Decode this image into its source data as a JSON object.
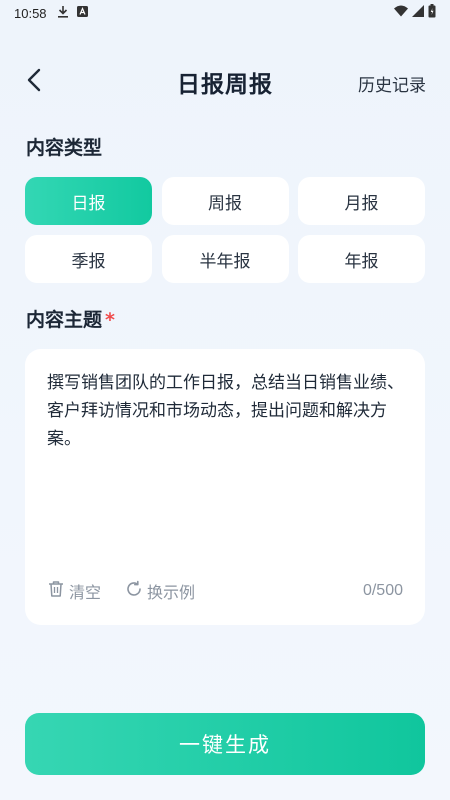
{
  "status_bar": {
    "time": "10:58",
    "left_icons": [
      "download-icon",
      "app-a-icon"
    ],
    "right_icons": [
      "wifi-icon",
      "signal-icon",
      "battery-icon"
    ]
  },
  "header": {
    "title": "日报周报",
    "back_icon": "chevron-left-icon",
    "history_label": "历史记录"
  },
  "content_type": {
    "label": "内容类型",
    "options": [
      "日报",
      "周报",
      "月报",
      "季报",
      "半年报",
      "年报"
    ],
    "selected": "日报"
  },
  "content_topic": {
    "label": "内容主题",
    "required_mark": "*",
    "text": "撰写销售团队的工作日报，总结当日销售业绩、客户拜访情况和市场动态，提出问题和解决方案。",
    "clear_label": "清空",
    "example_label": "换示例",
    "counter": "0/500"
  },
  "generate_button": {
    "label": "一键生成"
  },
  "colors": {
    "accent": "#1ccba5",
    "required": "#f04b4b",
    "muted": "#8c95a1"
  }
}
